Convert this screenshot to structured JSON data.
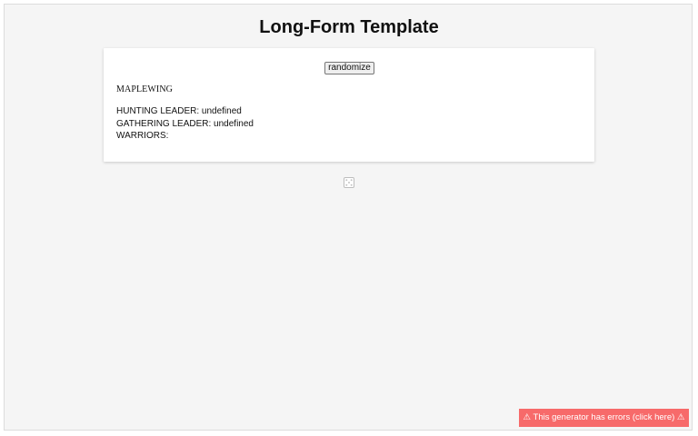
{
  "page": {
    "title": "Long-Form Template"
  },
  "card": {
    "randomize_label": "randomize",
    "clan_name": "MAPLEWING",
    "lines": [
      "HUNTING LEADER: undefined",
      "GATHERING LEADER: undefined",
      "WARRIORS:"
    ]
  },
  "footer": {
    "dice_icon": "dice-icon"
  },
  "error_banner": {
    "label": "⚠ This generator has errors (click here) ⚠"
  },
  "colors": {
    "background": "#f5f5f5",
    "card": "#ffffff",
    "error": "#f76a6a"
  }
}
